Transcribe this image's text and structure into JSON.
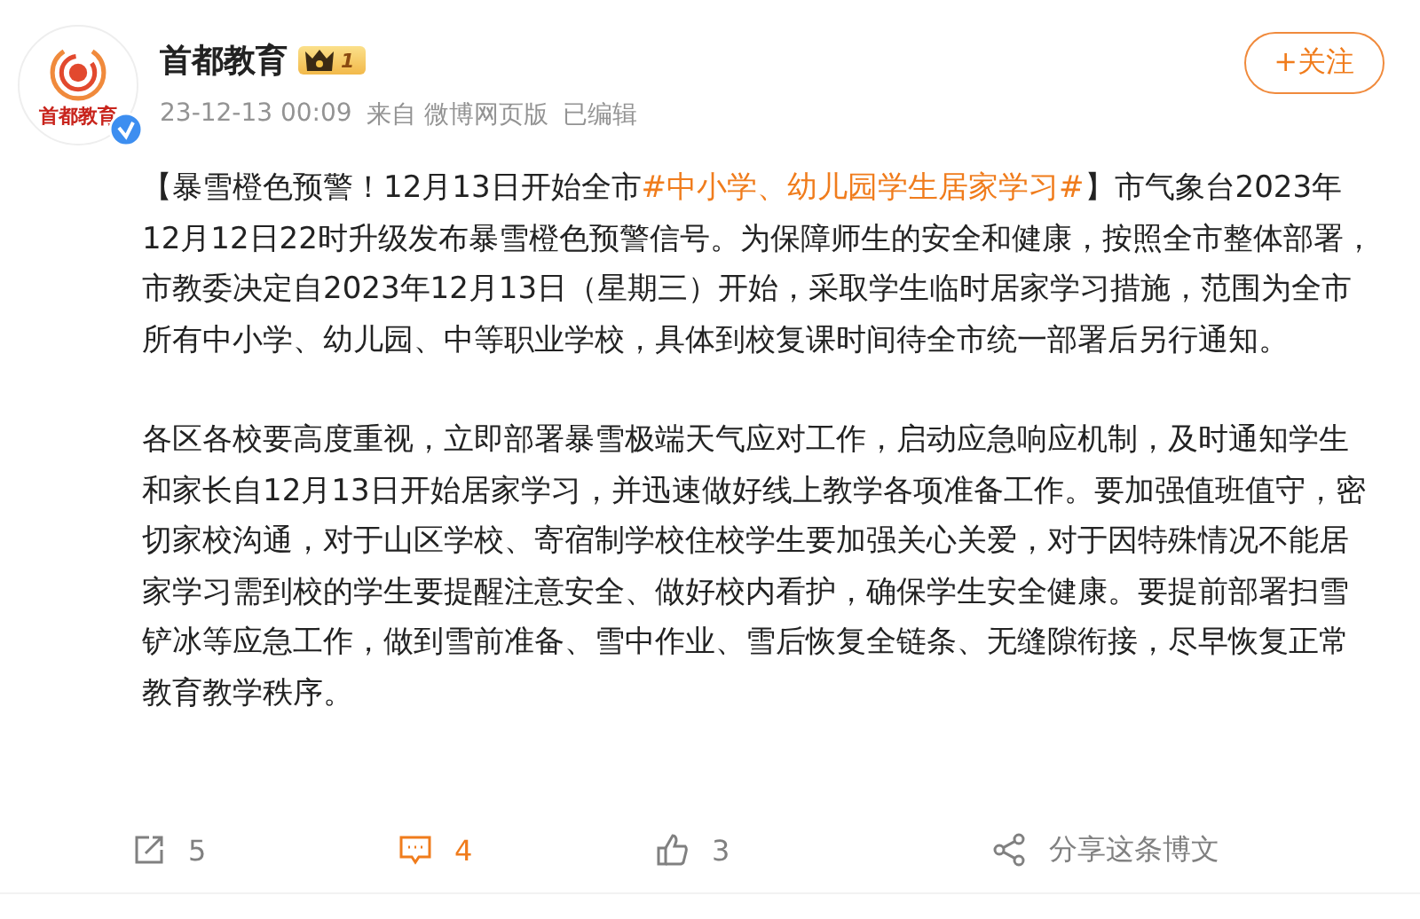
{
  "author": {
    "name": "首都教育",
    "avatar_text": "首都教育",
    "verified": true,
    "level_badge": "1"
  },
  "meta": {
    "time": "23-12-13 00:09",
    "source": "来自 微博网页版",
    "edited": "已编辑"
  },
  "follow_button": "+关注",
  "paragraphs": [
    {
      "segments": [
        {
          "kind": "text",
          "text": "【暴雪橙色预警！12月13日开始全市"
        },
        {
          "kind": "hashtag",
          "text": "#中小学、幼儿园学生居家学习#"
        },
        {
          "kind": "text",
          "text": "】市气象台2023年12月12日22时升级发布暴雪橙色预警信号。为保障师生的安全和健康，按照全市整体部署，市教委决定自2023年12月13日（星期三）开始，采取学生临时居家学习措施，范围为全市所有中小学、幼儿园、中等职业学校，具体到校复课时间待全市统一部署后另行通知。"
        }
      ]
    },
    {
      "segments": [
        {
          "kind": "text",
          "text": "各区各校要高度重视，立即部署暴雪极端天气应对工作，启动应急响应机制，及时通知学生和家长自12月13日开始居家学习，并迅速做好线上教学各项准备工作。要加强值班值守，密切家校沟通，对于山区学校、寄宿制学校住校学生要加强关心关爱，对于因特殊情况不能居家学习需到校的学生要提醒注意安全、做好校内看护，确保学生安全健康。要提前部署扫雪铲冰等应急工作，做到雪前准备、雪中作业、雪后恢复全链条、无缝隙衔接，尽早恢复正常教育教学秩序。"
        }
      ]
    }
  ],
  "actions": [
    {
      "kind": "repost",
      "label": "5",
      "selected": false
    },
    {
      "kind": "comment",
      "label": "4",
      "selected": true
    },
    {
      "kind": "like",
      "label": "3",
      "selected": false
    },
    {
      "kind": "share",
      "label": "分享这条博文",
      "selected": false
    }
  ]
}
